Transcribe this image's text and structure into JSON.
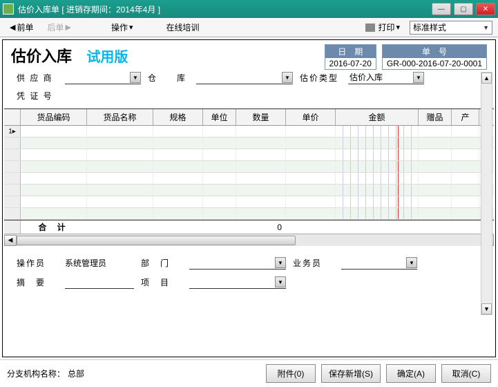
{
  "window": {
    "title": "估价入库单 [ 进销存期间：2014年4月 ]",
    "min": "—",
    "max": "▢",
    "close": "✕"
  },
  "toolbar": {
    "prev": "前单",
    "next": "后单",
    "operate": "操作",
    "training": "在线培训",
    "print": "打印",
    "style_selected": "标准样式"
  },
  "doc": {
    "title": "估价入库",
    "trial": "试用版",
    "date_label": "日　期",
    "date_value": "2016-07-20",
    "no_label": "单　号",
    "no_value": "GR-000-2016-07-20-0001",
    "supplier_label": "供 应 商",
    "warehouse_label": "仓　　库",
    "type_label": "估价类型",
    "type_value": "估价入库",
    "voucher_label": "凭 证 号"
  },
  "grid": {
    "cols": {
      "code": "货品编码",
      "name": "货品名称",
      "spec": "规格",
      "unit": "单位",
      "qty": "数量",
      "price": "单价",
      "amount": "金额",
      "gift": "赠品",
      "product": "产"
    },
    "total_label": "合 计",
    "total_qty": "0"
  },
  "lower": {
    "operator_label": "操作员",
    "operator_value": "系统管理员",
    "dept_label": "部　门",
    "sales_label": "业务员",
    "summary_label": "摘　要",
    "project_label": "项　目"
  },
  "status": {
    "branch_label": "分支机构名称：",
    "branch_value": "总部",
    "btn_attach": "附件(0)",
    "btn_savenew": "保存新增(S)",
    "btn_ok": "确定(A)",
    "btn_cancel": "取消(C)"
  }
}
